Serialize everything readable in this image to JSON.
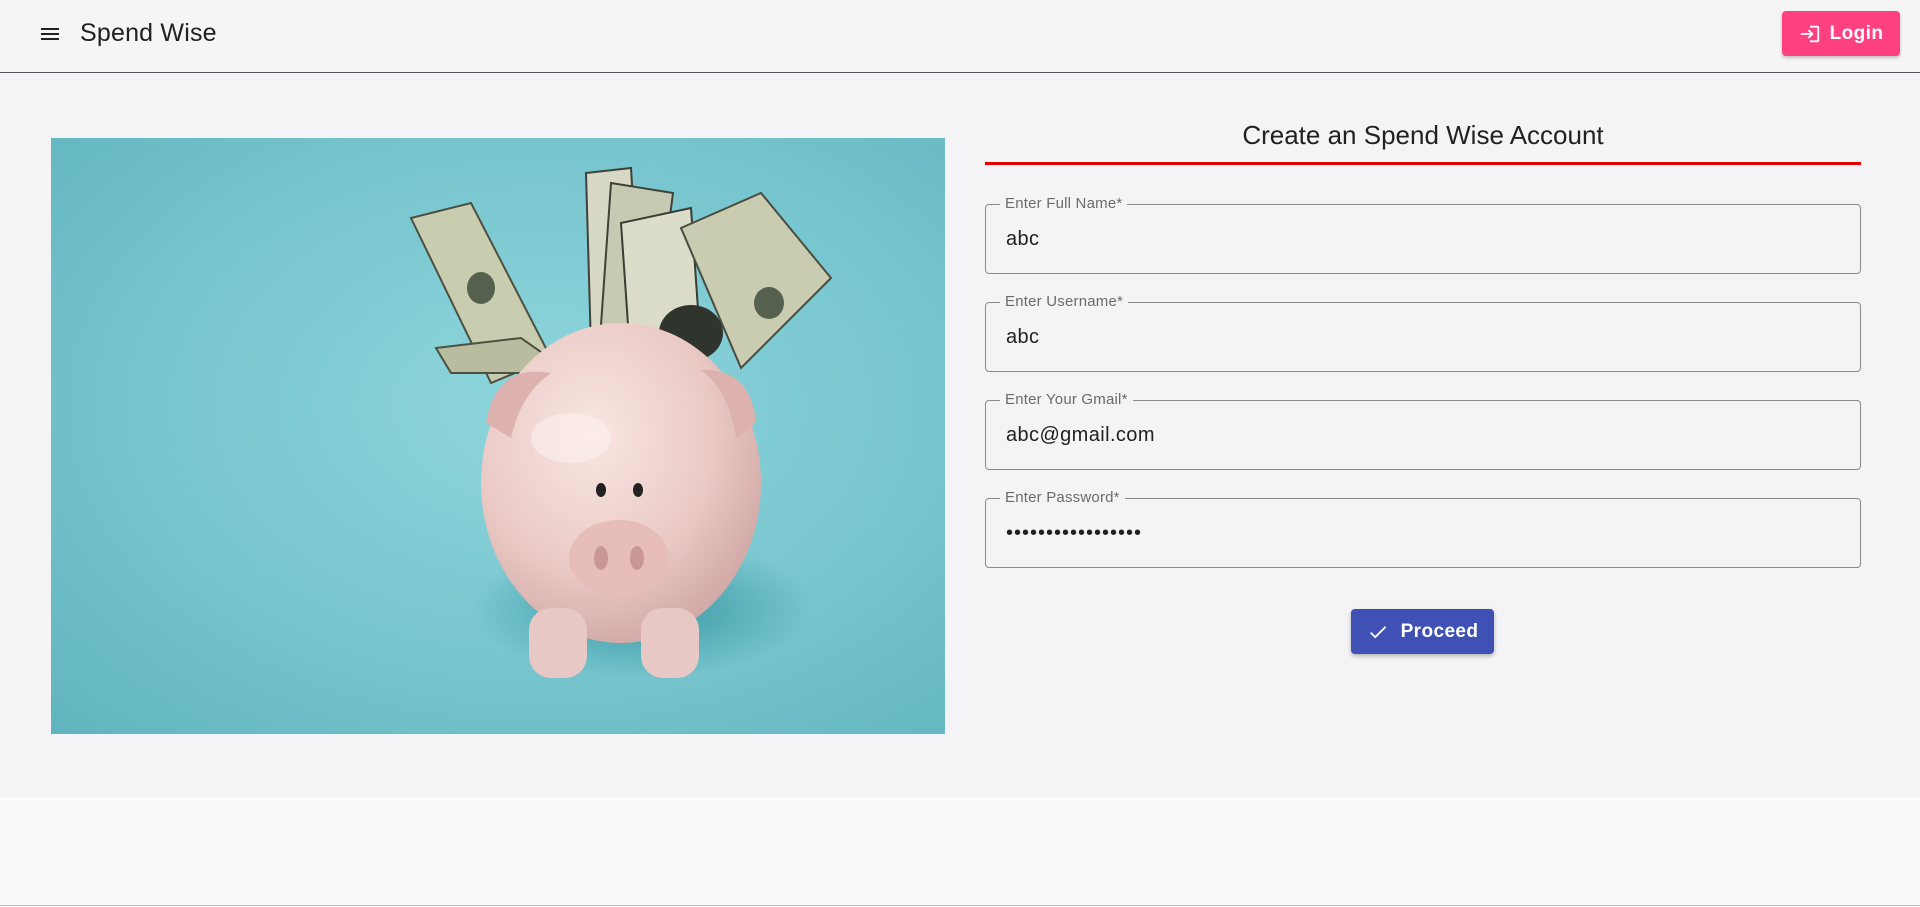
{
  "header": {
    "brand": "Spend Wise",
    "menu_icon": "menu-icon",
    "login_label": "Login",
    "login_icon": "login-icon"
  },
  "hero": {
    "image": "piggy-bank-with-dollar-bills",
    "colors": {
      "background": "#74c3cd",
      "pig": "#eccfcb"
    }
  },
  "form": {
    "title": "Create an Spend Wise Account",
    "fields": [
      {
        "label": "Enter Full Name*",
        "value": "abc"
      },
      {
        "label": "Enter Username*",
        "value": "abc"
      },
      {
        "label": "Enter Your Gmail*",
        "value": "abc@gmail.com"
      },
      {
        "label": "Enter Password*",
        "value": "•••••••••••••••••"
      }
    ],
    "proceed_label": "Proceed",
    "proceed_icon": "check-icon"
  },
  "colors": {
    "login_button": "#ff4081",
    "proceed_button": "#3f51b5",
    "title_underline": "#e00000"
  }
}
